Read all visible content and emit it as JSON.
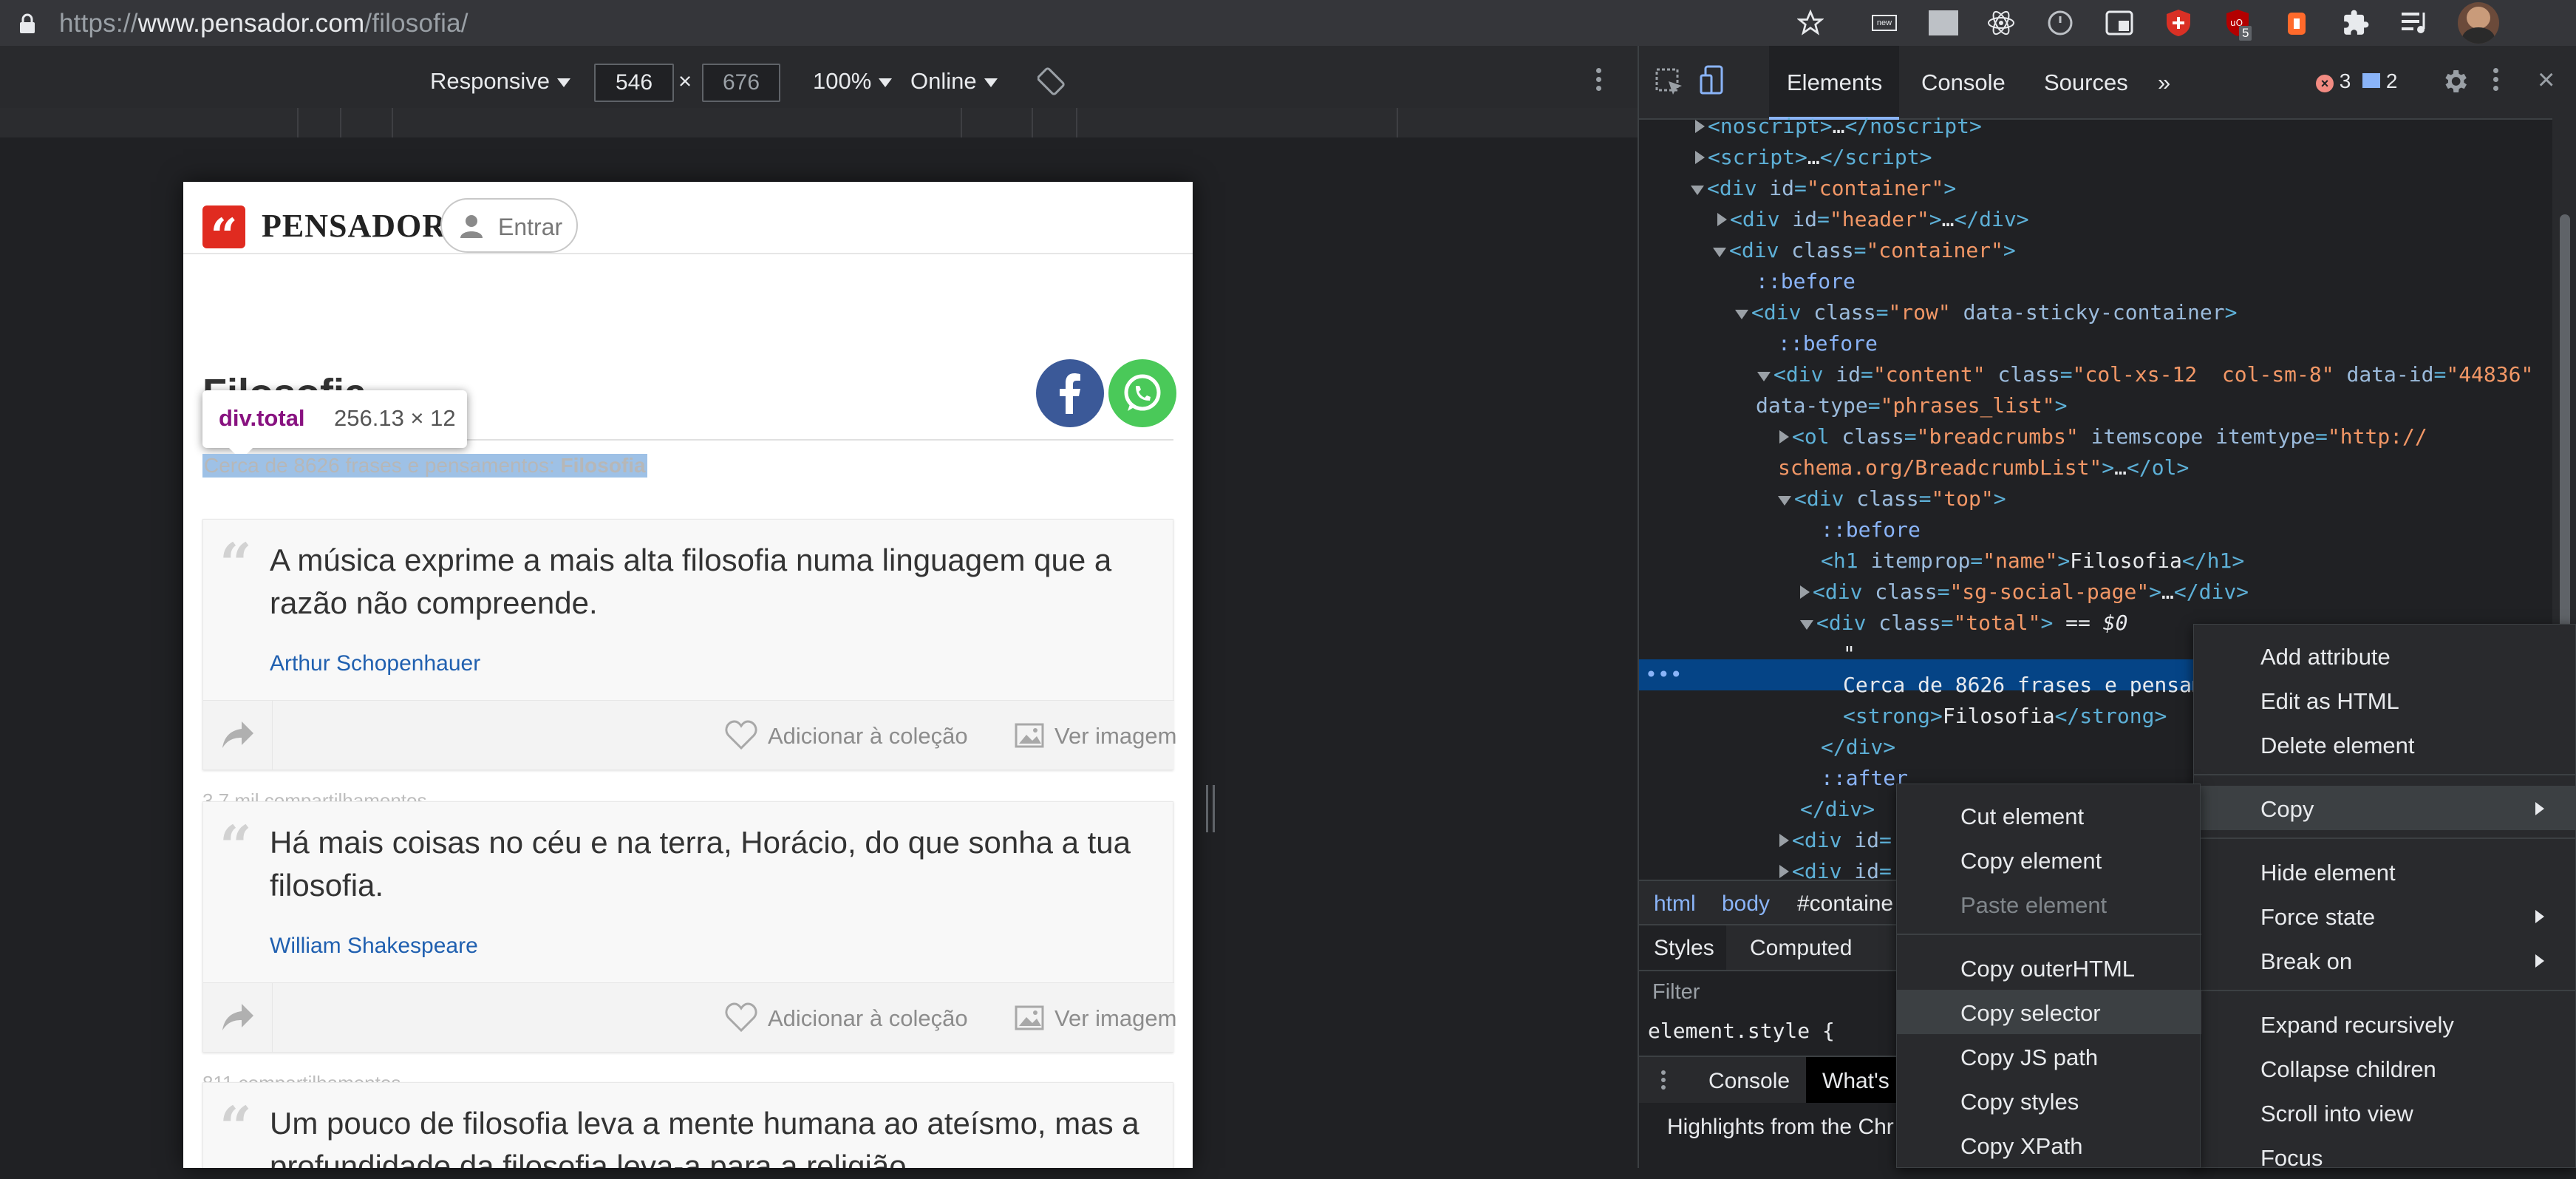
{
  "browser": {
    "url_scheme": "https://",
    "url_host": "www.pensador.com",
    "url_path": "/filosofia/",
    "extensions": [
      "bookmark-star-icon",
      "news-extension-icon",
      "video-speed-icon",
      "react-devtools-icon",
      "stopwatch-icon",
      "tab-manager-icon",
      "shield-icon",
      "ublock-icon",
      "ublock-badge",
      "flame-icon",
      "puzzle-icon",
      "playlist-icon",
      "profile-avatar"
    ],
    "ublock_badge": "5",
    "news_label": "new"
  },
  "device_toolbar": {
    "mode": "Responsive",
    "width": "546",
    "times": "×",
    "height": "676",
    "zoom": "100%",
    "network": "Online"
  },
  "page": {
    "brand": "PENSADOR",
    "login_label": "Entrar",
    "title": "Filosofia",
    "total_text": "Cerca de 8626 frases e pensamentos: ",
    "total_strong": "Filosofia",
    "tooltip": {
      "tag": "div",
      "cls": ".total",
      "size": "256.13 × 12"
    },
    "quotes": [
      {
        "text": "A música exprime a mais alta filosofia numa linguagem que a razão não compreende.",
        "author": "Arthur Schopenhauer",
        "meta": "3,7 mil compartilhamentos"
      },
      {
        "text": "Há mais coisas no céu e na terra, Horácio, do que sonha a tua filosofia.",
        "author": "William Shakespeare",
        "meta": "811 compartilhamentos"
      },
      {
        "text": "Um pouco de filosofia leva a mente humana ao ateísmo, mas a profundidade da filosofia leva-a para a religião.",
        "author": "",
        "meta": ""
      }
    ],
    "add_collection": "Adicionar à coleção",
    "view_image": "Ver imagem"
  },
  "devtools": {
    "tabs": [
      "Elements",
      "Console",
      "Sources",
      "»"
    ],
    "errors": "3",
    "messages": "2",
    "tree": [
      {
        "indent": 0,
        "toggle": "closed",
        "html": "noscript"
      },
      {
        "indent": 0,
        "toggle": "closed",
        "html": "script"
      },
      {
        "indent": 0,
        "toggle": "open",
        "html": "div-container"
      }
    ],
    "breadcrumbs": [
      "html",
      "body",
      "#containe"
    ],
    "subtabs": [
      "Styles",
      "Computed"
    ],
    "filter_placeholder": "Filter",
    "element_style": "element.style {",
    "drawer_tabs": [
      "Console",
      "What's"
    ],
    "drawer_text": "Highlights from the Chr"
  },
  "context_menu_main": [
    "Add attribute",
    "Edit as HTML",
    "Delete element",
    "Copy",
    "Hide element",
    "Force state",
    "Break on",
    "Expand recursively",
    "Collapse children",
    "Scroll into view",
    "Focus"
  ],
  "context_menu_copy": [
    "Cut element",
    "Copy element",
    "Paste element",
    "Copy outerHTML",
    "Copy selector",
    "Copy JS path",
    "Copy styles",
    "Copy XPath"
  ],
  "colors": {
    "brand_red": "#e02b20",
    "facebook": "#3b5998",
    "whatsapp": "#4ac959",
    "selection_blue": "#054486",
    "link_blue": "#2060b0"
  }
}
